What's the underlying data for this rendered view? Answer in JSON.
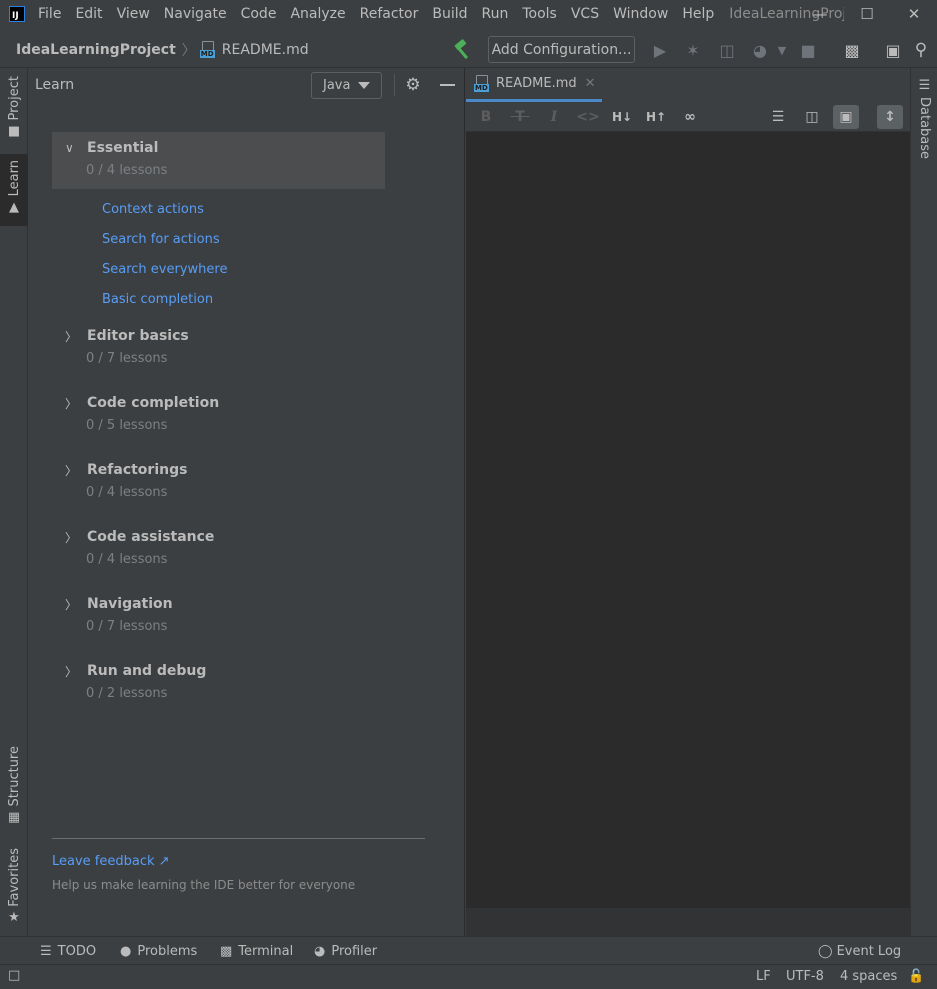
{
  "menubar": {
    "items": [
      "File",
      "Edit",
      "View",
      "Navigate",
      "Code",
      "Analyze",
      "Refactor",
      "Build",
      "Run",
      "Tools",
      "VCS",
      "Window",
      "Help"
    ],
    "window_title": "IdeaLearningProjec"
  },
  "navbar": {
    "project": "IdeaLearningProject",
    "file": "README.md",
    "file_icon_tag": "MD",
    "add_configuration": "Add Configuration..."
  },
  "left_stripe": {
    "project": "Project",
    "learn": "Learn",
    "structure": "Structure",
    "favorites": "Favorites"
  },
  "learn": {
    "title": "Learn",
    "language": "Java",
    "modules": [
      {
        "title": "Essential",
        "count": "0 / 4 lessons",
        "expanded": true
      },
      {
        "title": "Editor basics",
        "count": "0 / 7 lessons"
      },
      {
        "title": "Code completion",
        "count": "0 / 5 lessons"
      },
      {
        "title": "Refactorings",
        "count": "0 / 4 lessons"
      },
      {
        "title": "Code assistance",
        "count": "0 / 4 lessons"
      },
      {
        "title": "Navigation",
        "count": "0 / 7 lessons"
      },
      {
        "title": "Run and debug",
        "count": "0 / 2 lessons"
      }
    ],
    "lessons": [
      "Context actions",
      "Search for actions",
      "Search everywhere",
      "Basic completion"
    ],
    "feedback_link": "Leave feedback ↗",
    "feedback_desc": "Help us make learning the IDE better for everyone"
  },
  "editor": {
    "tab": "README.md",
    "toolbar": {
      "bold": "B",
      "heading_down": "H↓",
      "heading_up": "H↑"
    }
  },
  "right_stripe": {
    "database": "Database"
  },
  "toolwindows": {
    "todo": "TODO",
    "problems": "Problems",
    "terminal": "Terminal",
    "profiler": "Profiler",
    "event_log": "Event Log"
  },
  "status": {
    "line_separator": "LF",
    "encoding": "UTF-8",
    "indent": "4 spaces"
  },
  "colors": {
    "link": "#589df6",
    "background": "#3c3f41",
    "editor": "#2b2b2b",
    "build_hammer": "#4cb05a",
    "tab_underline": "#4a88c7"
  }
}
